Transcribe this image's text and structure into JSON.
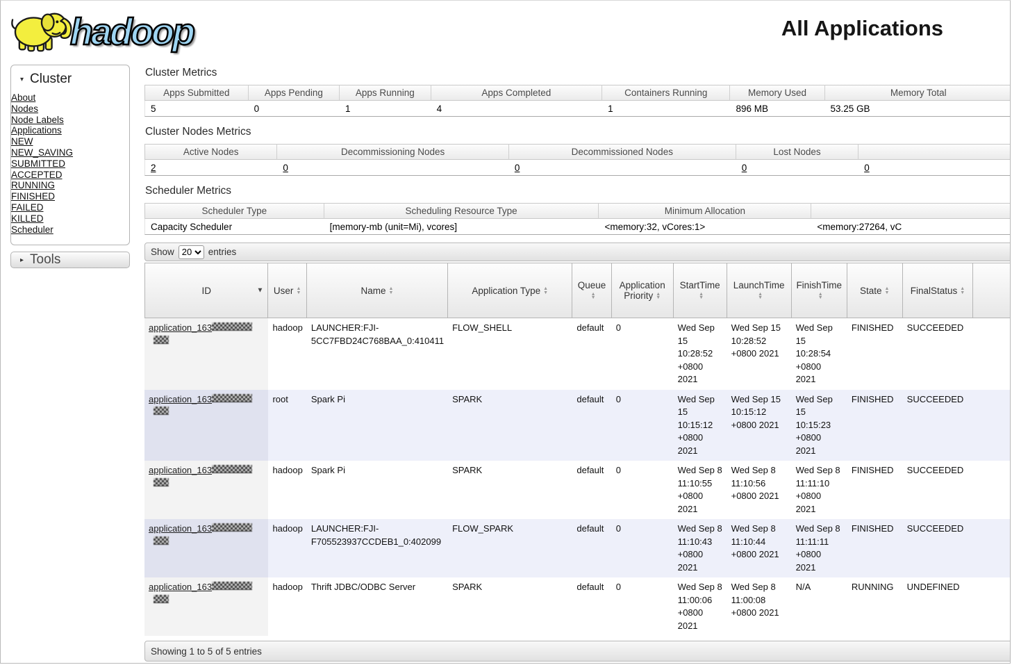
{
  "icons": {
    "collapse": "▾",
    "expand": "▸",
    "sorted_desc": "▼",
    "up": "▲",
    "down": "▼"
  },
  "header": {
    "logo_text": "hadoop",
    "title": "All Applications"
  },
  "sidebar": {
    "cluster": {
      "title": "Cluster",
      "items": [
        {
          "label": "About"
        },
        {
          "label": "Nodes"
        },
        {
          "label": "Node Labels"
        },
        {
          "label": "Applications"
        }
      ],
      "app_states": [
        {
          "label": "NEW"
        },
        {
          "label": "NEW_SAVING"
        },
        {
          "label": "SUBMITTED"
        },
        {
          "label": "ACCEPTED"
        },
        {
          "label": "RUNNING"
        },
        {
          "label": "FINISHED"
        },
        {
          "label": "FAILED"
        },
        {
          "label": "KILLED"
        }
      ],
      "scheduler_label": "Scheduler"
    },
    "tools": {
      "title": "Tools"
    }
  },
  "cluster_metrics": {
    "heading": "Cluster Metrics",
    "columns": [
      "Apps Submitted",
      "Apps Pending",
      "Apps Running",
      "Apps Completed",
      "Containers Running",
      "Memory Used",
      "Memory Total"
    ],
    "values": [
      "5",
      "0",
      "1",
      "4",
      "1",
      "896 MB",
      "53.25 GB"
    ]
  },
  "cluster_nodes_metrics": {
    "heading": "Cluster Nodes Metrics",
    "columns": [
      "Active Nodes",
      "Decommissioning Nodes",
      "Decommissioned Nodes",
      "Lost Nodes",
      ""
    ],
    "values": [
      "2",
      "0",
      "0",
      "0",
      "0"
    ]
  },
  "scheduler_metrics": {
    "heading": "Scheduler Metrics",
    "columns": [
      "Scheduler Type",
      "Scheduling Resource Type",
      "Minimum Allocation",
      ""
    ],
    "values": [
      "Capacity Scheduler",
      "[memory-mb (unit=Mi), vcores]",
      "<memory:32, vCores:1>",
      "<memory:27264, vC"
    ]
  },
  "apps_table": {
    "show_label": "Show",
    "page_size": "20",
    "entries_label": "entries",
    "columns": [
      "ID",
      "User",
      "Name",
      "Application Type",
      "Queue",
      "Application Priority",
      "StartTime",
      "LaunchTime",
      "FinishTime",
      "State",
      "FinalStatus"
    ],
    "rows": [
      {
        "id_prefix": "application_163",
        "user": "hadoop",
        "name": "LAUNCHER:FJI-5CC7FBD24C768BAA_0:410411",
        "type": "FLOW_SHELL",
        "queue": "default",
        "priority": "0",
        "start_time": "Wed Sep 15 10:28:52 +0800 2021",
        "launch_time": "Wed Sep 15 10:28:52 +0800 2021",
        "finish_time": "Wed Sep 15 10:28:54 +0800 2021",
        "state": "FINISHED",
        "final_status": "SUCCEEDED"
      },
      {
        "id_prefix": "application_163",
        "user": "root",
        "name": "Spark Pi",
        "type": "SPARK",
        "queue": "default",
        "priority": "0",
        "start_time": "Wed Sep 15 10:15:12 +0800 2021",
        "launch_time": "Wed Sep 15 10:15:12 +0800 2021",
        "finish_time": "Wed Sep 15 10:15:23 +0800 2021",
        "state": "FINISHED",
        "final_status": "SUCCEEDED"
      },
      {
        "id_prefix": "application_163",
        "user": "hadoop",
        "name": "Spark Pi",
        "type": "SPARK",
        "queue": "default",
        "priority": "0",
        "start_time": "Wed Sep 8 11:10:55 +0800 2021",
        "launch_time": "Wed Sep 8 11:10:56 +0800 2021",
        "finish_time": "Wed Sep 8 11:11:10 +0800 2021",
        "state": "FINISHED",
        "final_status": "SUCCEEDED"
      },
      {
        "id_prefix": "application_163",
        "user": "hadoop",
        "name": "LAUNCHER:FJI-F705523937CCDEB1_0:402099",
        "type": "FLOW_SPARK",
        "queue": "default",
        "priority": "0",
        "start_time": "Wed Sep 8 11:10:43 +0800 2021",
        "launch_time": "Wed Sep 8 11:10:44 +0800 2021",
        "finish_time": "Wed Sep 8 11:11:11 +0800 2021",
        "state": "FINISHED",
        "final_status": "SUCCEEDED"
      },
      {
        "id_prefix": "application_163",
        "user": "hadoop",
        "name": "Thrift JDBC/ODBC Server",
        "type": "SPARK",
        "queue": "default",
        "priority": "0",
        "start_time": "Wed Sep 8 11:00:06 +0800 2021",
        "launch_time": "Wed Sep 8 11:00:08 +0800 2021",
        "finish_time": "N/A",
        "state": "RUNNING",
        "final_status": "UNDEFINED"
      }
    ],
    "footer": "Showing 1 to 5 of 5 entries"
  }
}
